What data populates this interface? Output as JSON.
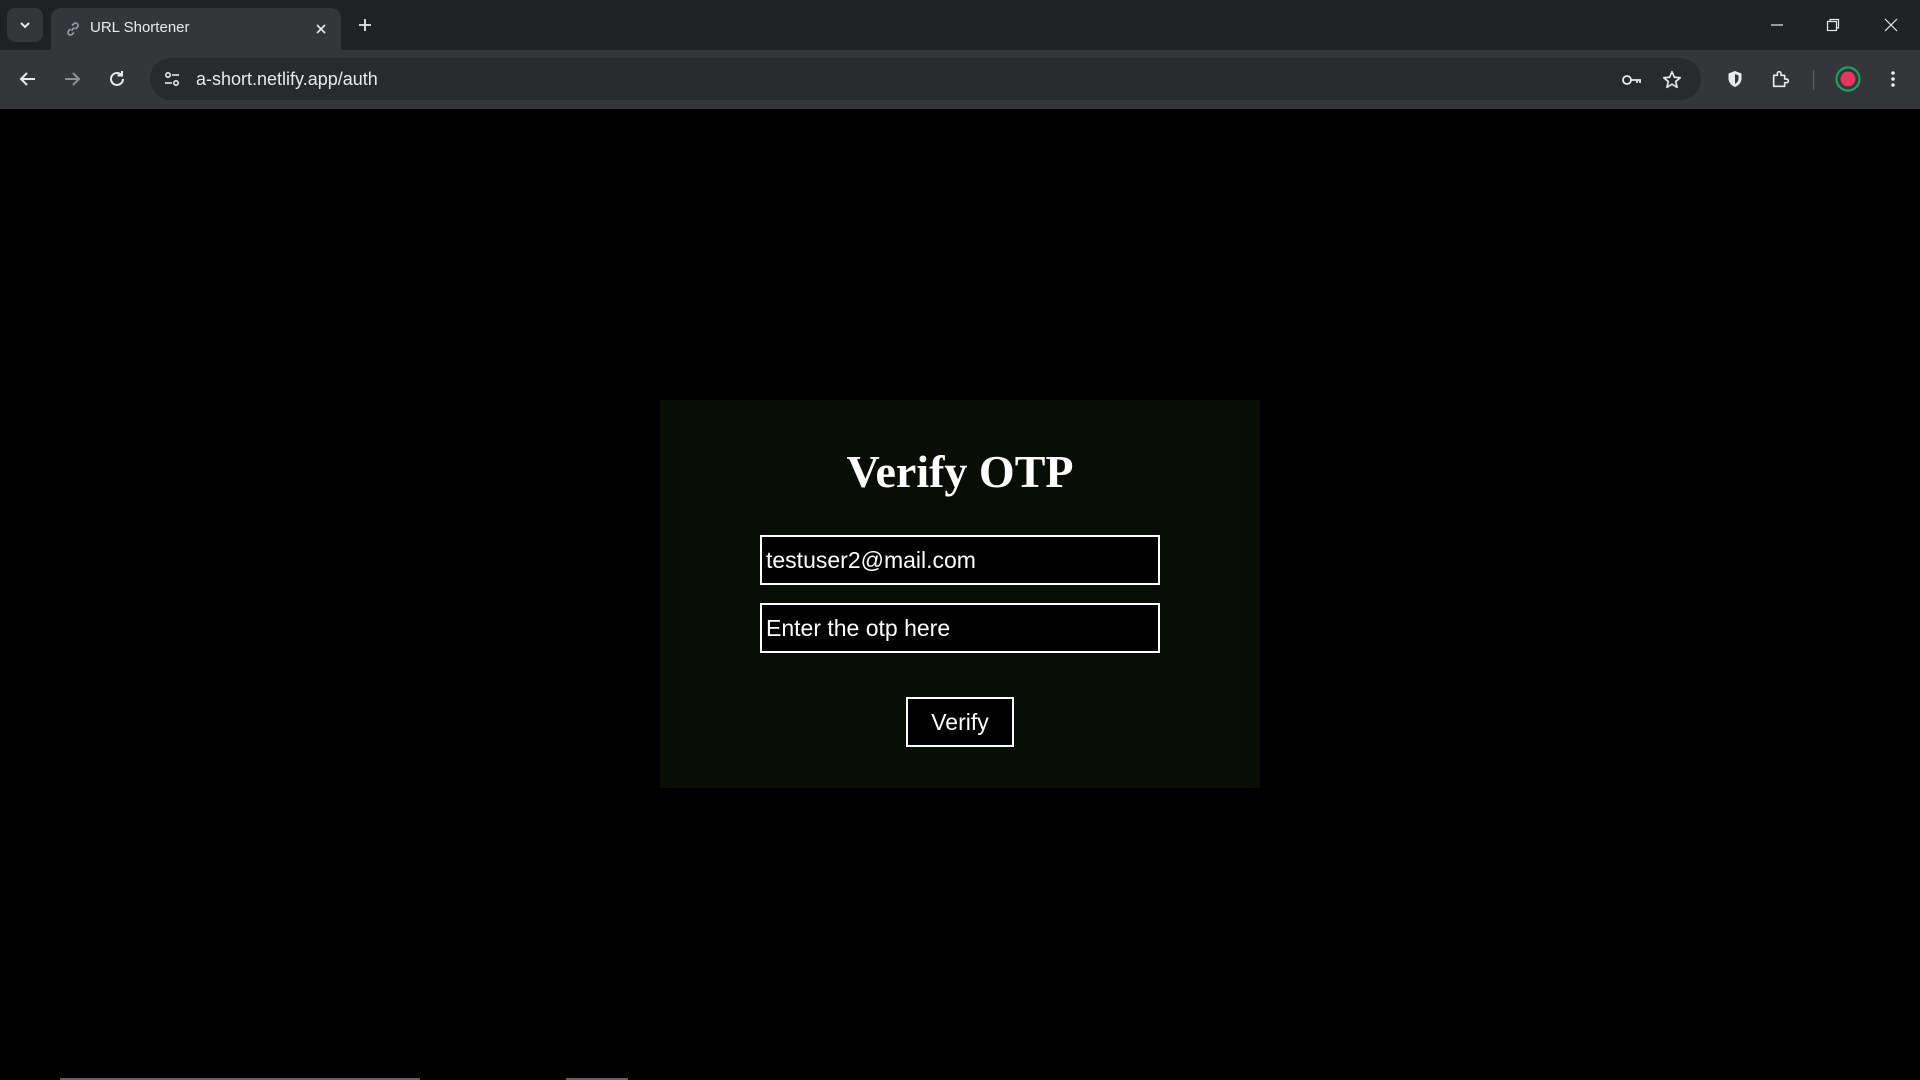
{
  "browser": {
    "tab": {
      "title": "URL Shortener",
      "favicon": "link-icon"
    },
    "address": {
      "url": "a-short.netlify.app/auth"
    },
    "icons": {
      "tab_search": "chevron-down-icon",
      "tab_close": "close-icon",
      "new_tab": "plus-icon",
      "minimize": "minimize-icon",
      "restore": "restore-icon",
      "close_window": "close-icon",
      "back": "back-arrow-icon",
      "forward": "forward-arrow-icon",
      "reload": "reload-icon",
      "site_info": "tune-icon",
      "passwords": "key-icon",
      "bookmark": "star-icon",
      "extension_shield": "shield-icon",
      "extensions": "puzzle-icon",
      "profile": "avatar-icon",
      "menu": "more-vert-icon"
    },
    "colors": {
      "frame": "#202124",
      "toolbar": "#35363a",
      "omnibox": "#282a2d",
      "profile_ring": "#1aa260",
      "profile_dot": "#e8345a"
    }
  },
  "page": {
    "title": "Verify OTP",
    "email_field": {
      "value": "testuser2@mail.com"
    },
    "otp_field": {
      "value": "",
      "placeholder": "Enter the otp here"
    },
    "verify_button": {
      "label": "Verify"
    },
    "colors": {
      "background": "#000000",
      "card": "#0a0c06",
      "text": "#ffffff",
      "border": "#ffffff"
    }
  }
}
